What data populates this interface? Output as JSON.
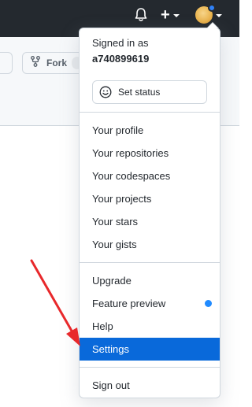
{
  "header": {
    "bell_icon": "bell-icon",
    "plus_icon": "plus-icon",
    "plus_symbol": "+",
    "avatar_icon": "user-avatar",
    "notification_dot_color": "#2f81f7"
  },
  "repo_toolbar": {
    "fork_label": "Fork",
    "fork_icon": "repo-forked-icon"
  },
  "dropdown": {
    "signed_in_as": "Signed in as",
    "username": "a740899619",
    "set_status_label": "Set status",
    "set_status_icon": "smiley-icon",
    "items": [
      {
        "label": "Your profile"
      },
      {
        "label": "Your repositories"
      },
      {
        "label": "Your codespaces"
      },
      {
        "label": "Your projects"
      },
      {
        "label": "Your stars"
      },
      {
        "label": "Your gists"
      }
    ],
    "items2": [
      {
        "label": "Upgrade"
      },
      {
        "label": "Feature preview"
      },
      {
        "label": "Help"
      },
      {
        "label": "Settings"
      }
    ],
    "signout_label": "Sign out",
    "active_item": "Settings",
    "active_color": "#0969da"
  },
  "annotation": {
    "arrow_color": "#e8282b",
    "points_to": "Settings"
  }
}
